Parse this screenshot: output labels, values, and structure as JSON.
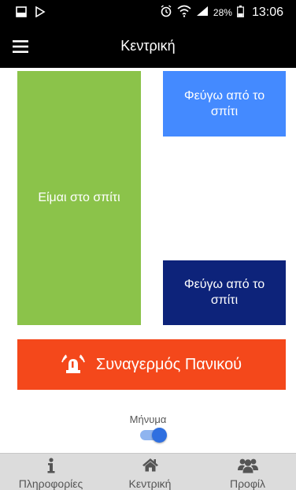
{
  "status_bar": {
    "battery_percent": "28%",
    "time": "13:06",
    "icons": [
      "screenshot-icon",
      "play-store-icon",
      "alarm-icon",
      "wifi-icon",
      "signal-icon",
      "battery-icon"
    ]
  },
  "app_bar": {
    "title": "Κεντρική"
  },
  "tiles": {
    "at_home": "Είμαι στο σπίτι",
    "leave_top": "Φεύγω από το σπίτι",
    "leave_bottom": "Φεύγω από το σπίτι"
  },
  "panic": {
    "label": "Συναγερμός Πανικού"
  },
  "message": {
    "label": "Μήνυμα",
    "enabled": true
  },
  "bottom_nav": {
    "items": [
      {
        "label": "Πληροφορίες",
        "icon": "info-icon"
      },
      {
        "label": "Κεντρική",
        "icon": "home-icon"
      },
      {
        "label": "Προφίλ",
        "icon": "users-icon"
      }
    ]
  },
  "colors": {
    "green": "#8bc34a",
    "light_blue": "#448aff",
    "dark_blue": "#0d237a",
    "panic_red": "#f4481b",
    "toggle_blue": "#2f6fe0"
  }
}
